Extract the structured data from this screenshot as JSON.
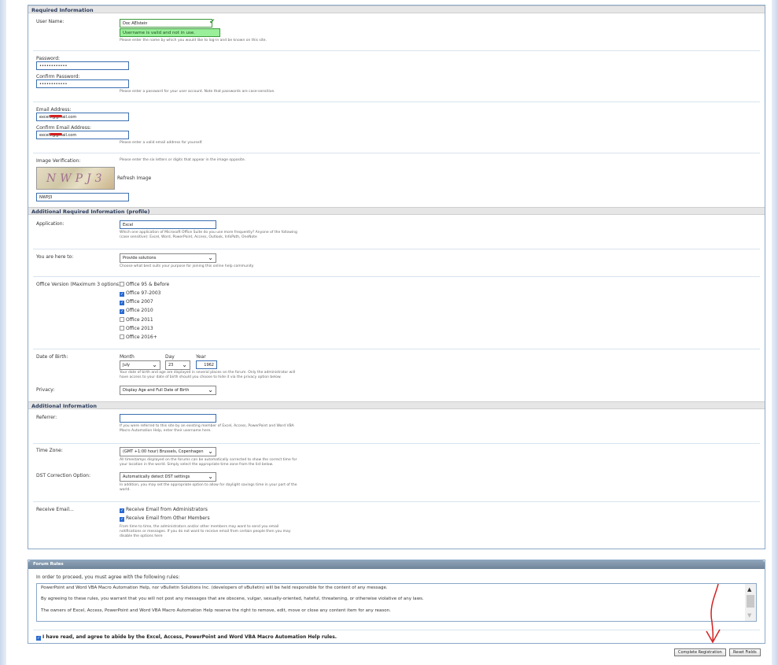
{
  "required": {
    "header": "Required Information",
    "username_label": "User Name:",
    "username_value": "Doc AElstein",
    "username_valid": "Username is valid and not in use.",
    "username_note": "Please enter the name by which you would like to log-in and be known on this site.",
    "password_label": "Password:",
    "password_value": "••••••••••••",
    "confirm_password_label": "Confirm Password:",
    "confirm_password_value": "••••••••••••",
    "password_note": "Please enter a password for your user account. Note that passwords are case-sensitive.",
    "email_label": "Email Address:",
    "email_value": "excelv@gmail.com",
    "confirm_email_label": "Confirm Email Address:",
    "confirm_email_value": "excelv@gmail.com",
    "email_note": "Please enter a valid email address for yourself.",
    "image_label": "Image Verification:",
    "image_note": "Please enter the six letters or digits that appear in the image opposite.",
    "captcha_text": "NWPJ3",
    "refresh_label": "Refresh Image",
    "image_value": "NWPJ3"
  },
  "profile": {
    "header": "Additional Required Information (profile)",
    "application_label": "Application:",
    "application_value": "Excel",
    "application_note1": "Which one application of Microsoft Office Suite do you use more frequently? Anyone of the following",
    "application_note2": "(case sensitive): Excel, Word, PowerPoint, Access, Outlook, InfoPath, OneNote",
    "here_label": "You are here to:",
    "here_value": "Provide solutions",
    "here_note": "Choose what best suits your purpose for joining this online help community",
    "office_label": "Office Version (Maximum 3 options):",
    "office_options": [
      {
        "label": "Office 95 & Before",
        "checked": false
      },
      {
        "label": "Office 97-2003",
        "checked": true
      },
      {
        "label": "Office 2007",
        "checked": true
      },
      {
        "label": "Office 2010",
        "checked": true
      },
      {
        "label": "Office 2011",
        "checked": false
      },
      {
        "label": "Office 2013",
        "checked": false
      },
      {
        "label": "Office 2016+",
        "checked": false
      }
    ],
    "dob_label": "Date of Birth:",
    "month_label": "Month",
    "month_value": "July",
    "day_label": "Day",
    "day_value": "23",
    "year_label": "Year",
    "year_value": "1962",
    "dob_note1": "Your date of birth and age are displayed in several places on the forum. Only the administrator will",
    "dob_note2": "have access to your date of birth should you choose to hide it via the privacy option below.",
    "privacy_label": "Privacy:",
    "privacy_value": "Display Age and Full Date of Birth"
  },
  "additional": {
    "header": "Additional Information",
    "referrer_label": "Referrer:",
    "referrer_value": "",
    "referrer_note1": "If you were referred to this site by an existing member of Excel, Access, PowerPoint and Word VBA",
    "referrer_note2": "Macro Automation Help, enter their username here.",
    "timezone_label": "Time Zone:",
    "timezone_value": "(GMT +1:00 hour) Brussels, Copenhagen",
    "timezone_note1": "All timestamps displayed on the forums can be automatically corrected to show the correct time for",
    "timezone_note2": "your location in the world. Simply select the appropriate time zone from the list below.",
    "dst_label": "DST Correction Option:",
    "dst_value": "Automatically detect DST settings",
    "dst_note1": "In addition, you may set the appropriate option to allow for daylight savings time in your part of the",
    "dst_note2": "world.",
    "email_label": "Receive Email...",
    "email_admin": "Receive Email from Administrators",
    "email_members": "Receive Email from Other Members",
    "email_note1": "From time to time, the administrators and/or other members may want to send you email",
    "email_note2": "notifications or messages. If you do not want to receive email from certain people then you may",
    "email_note3": "disable the options here"
  },
  "rules": {
    "header": "Forum Rules",
    "intro": "In order to proceed, you must agree with the following rules:",
    "line1": "PowerPoint and Word VBA Macro Automation Help, nor vBulletin Solutions Inc. (developers of vBulletin) will be held responsible for the content of any message.",
    "line2": "By agreeing to these rules, you warrant that you will not post any messages that are obscene, vulgar, sexually-oriented, hateful, threatening, or otherwise violative of any laws.",
    "line3": "The owners of Excel, Access, PowerPoint and Word VBA Macro Automation Help reserve the right to remove, edit, move or close any content item for any reason.",
    "agree": "I have read, and agree to abide by the Excel, Access, PowerPoint and Word VBA Macro Automation Help rules."
  },
  "buttons": {
    "complete": "Complete Registration",
    "reset": "Reset Fields"
  },
  "colors": {
    "accent": "#3b6fb0",
    "annotation": "#d42020"
  }
}
